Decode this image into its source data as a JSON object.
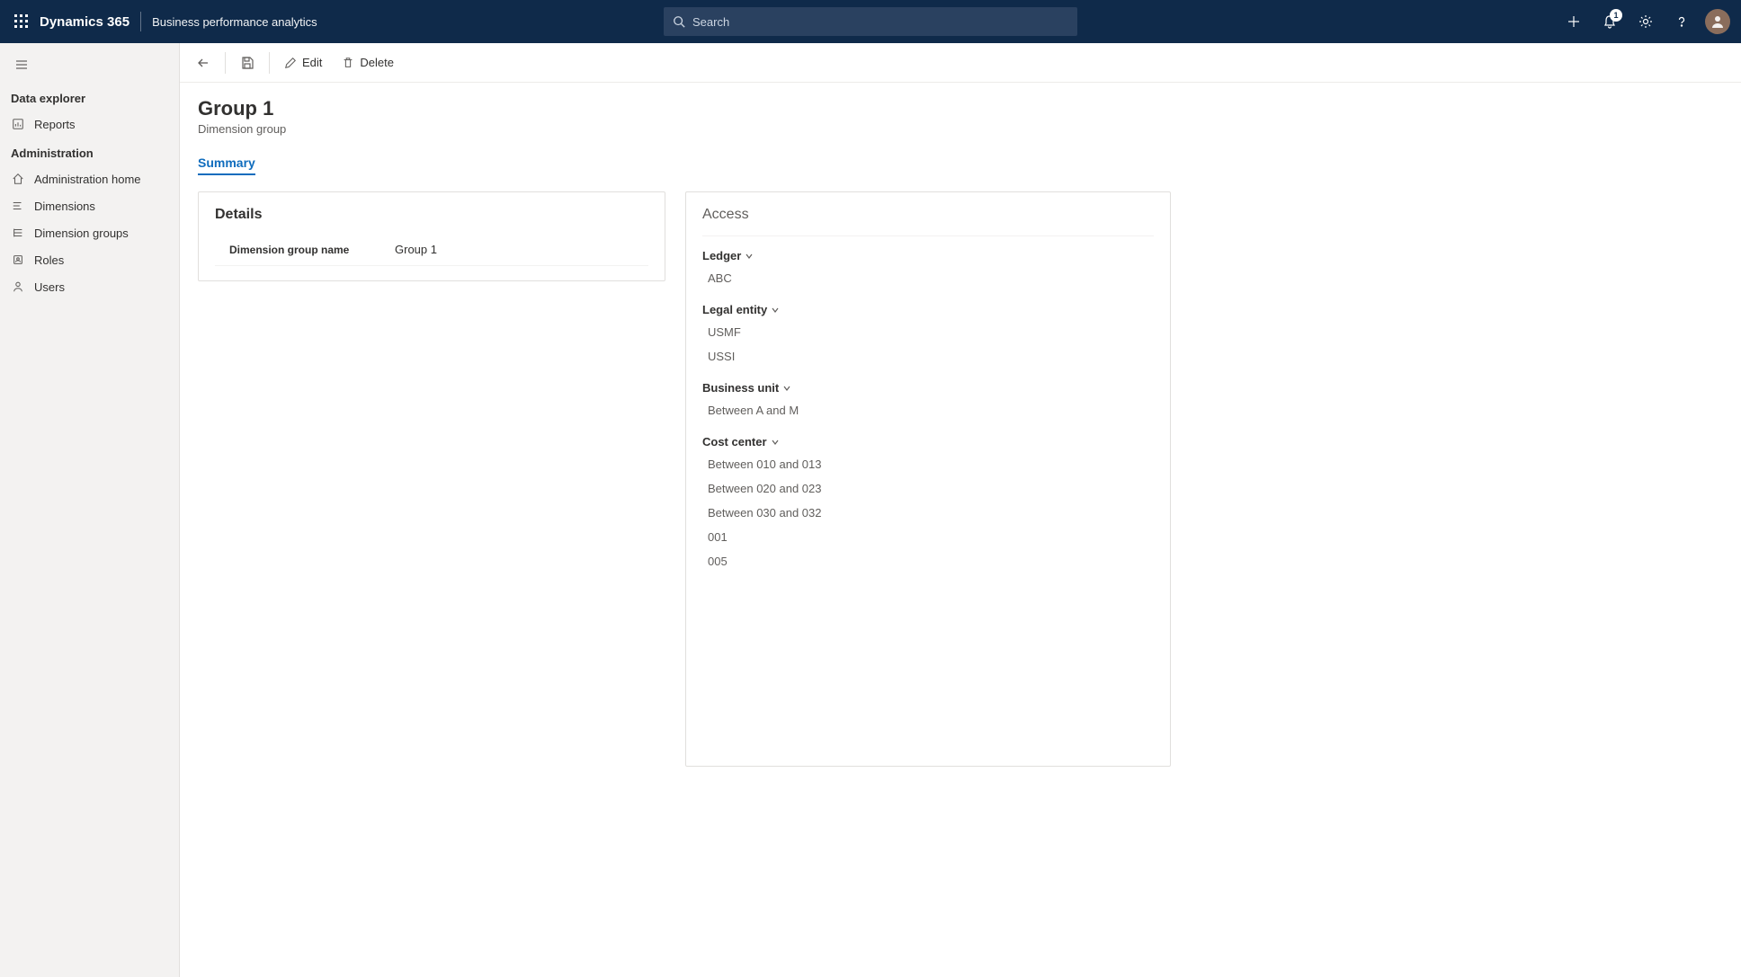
{
  "header": {
    "brand": "Dynamics 365",
    "subbrand": "Business performance analytics",
    "search_placeholder": "Search",
    "notification_count": "1"
  },
  "sidenav": {
    "sections": [
      {
        "title": "Data explorer",
        "items": [
          {
            "id": "reports",
            "label": "Reports",
            "icon": "reports-icon"
          }
        ]
      },
      {
        "title": "Administration",
        "items": [
          {
            "id": "admin-home",
            "label": "Administration home",
            "icon": "home-icon"
          },
          {
            "id": "dimensions",
            "label": "Dimensions",
            "icon": "dimensions-icon"
          },
          {
            "id": "dimension-groups",
            "label": "Dimension groups",
            "icon": "dimension-groups-icon",
            "active": true
          },
          {
            "id": "roles",
            "label": "Roles",
            "icon": "roles-icon"
          },
          {
            "id": "users",
            "label": "Users",
            "icon": "users-icon"
          }
        ]
      }
    ]
  },
  "commandbar": {
    "edit": "Edit",
    "delete": "Delete"
  },
  "page": {
    "title": "Group 1",
    "subtitle": "Dimension group",
    "tab_summary": "Summary"
  },
  "details": {
    "card_title": "Details",
    "fields": [
      {
        "label": "Dimension group name",
        "value": "Group 1"
      }
    ]
  },
  "access": {
    "card_title": "Access",
    "groups": [
      {
        "title": "Ledger",
        "items": [
          "ABC"
        ]
      },
      {
        "title": "Legal entity",
        "items": [
          "USMF",
          "USSI"
        ]
      },
      {
        "title": "Business unit",
        "items": [
          "Between A and M"
        ]
      },
      {
        "title": "Cost center",
        "items": [
          "Between 010 and 013",
          "Between 020 and 023",
          "Between 030 and 032",
          "001",
          "005"
        ]
      }
    ]
  }
}
